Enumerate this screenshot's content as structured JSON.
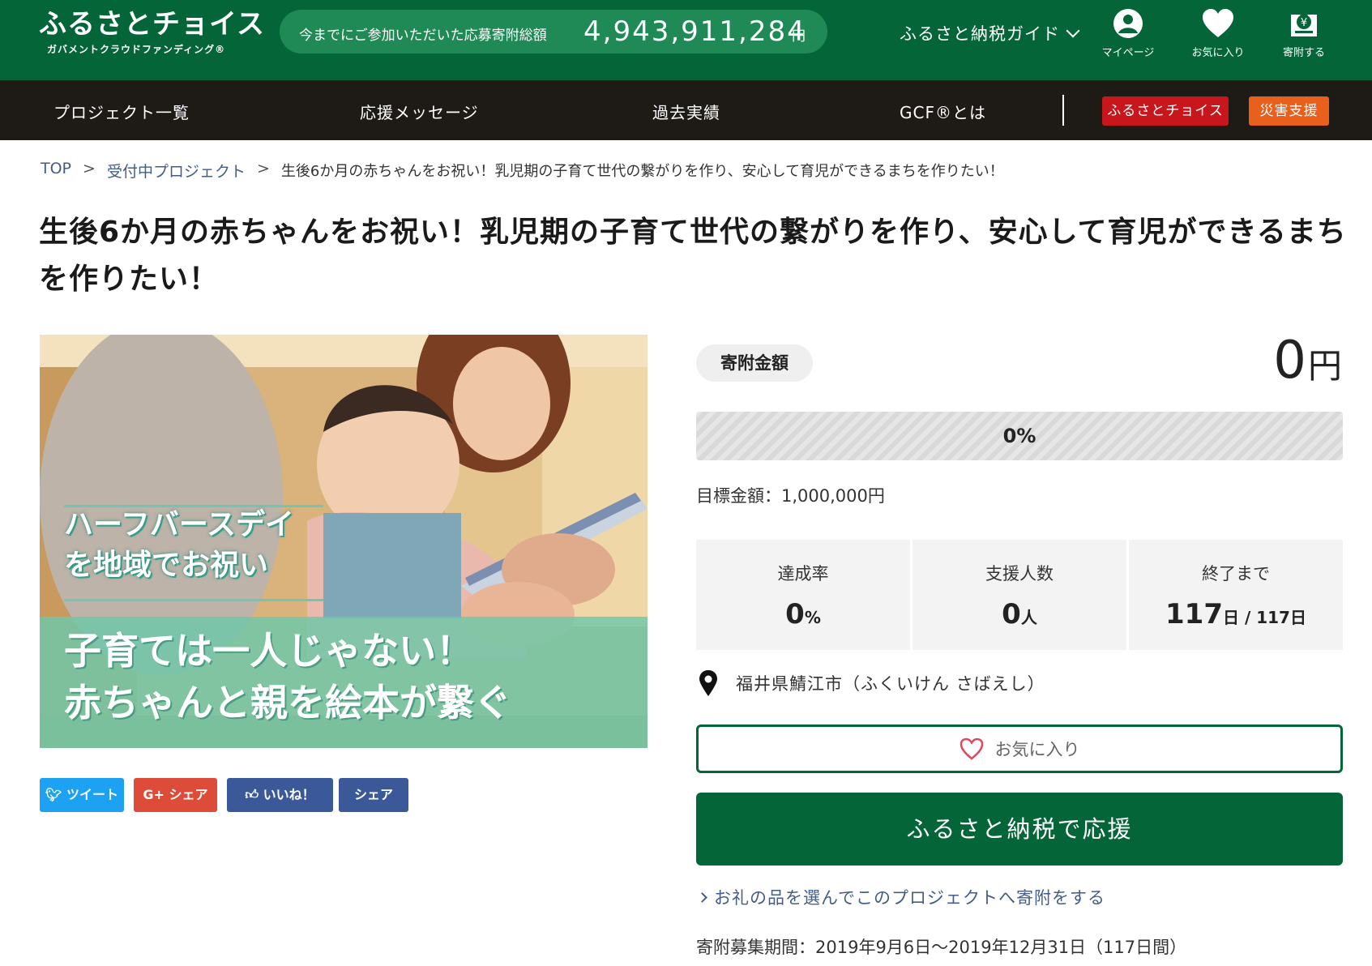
{
  "header": {
    "logo_main": "ふるさとチョイス",
    "logo_sub": "ガバメントクラウドファンディング®",
    "total_label": "今までにご参加いただいた応募寄附総額",
    "total_value": "4,943,911,284",
    "total_unit": "円",
    "guide_label": "ふるさと納税ガイド",
    "icons": [
      {
        "label": "マイページ",
        "icon": "user-icon"
      },
      {
        "label": "お気に入り",
        "icon": "heart-icon"
      },
      {
        "label": "寄附する",
        "icon": "donate-icon"
      }
    ]
  },
  "nav": {
    "items": [
      "プロジェクト一覧",
      "応援メッセージ",
      "過去実績",
      "GCF®とは"
    ],
    "btn_choice": "ふるさとチョイス",
    "btn_disaster": "災害支援",
    "colors": {
      "bg": "#1e1b17",
      "choice": "#c8161d",
      "disaster": "#e8601c"
    }
  },
  "breadcrumb": {
    "top": "TOP",
    "sep": ">",
    "projects": "受付中プロジェクト",
    "current": "生後6か月の赤ちゃんをお祝い！乳児期の子育て世代の繋がりを作り、安心して育児ができるまちを作りたい！"
  },
  "title": "生後6か月の赤ちゃんをお祝い！乳児期の子育て世代の繋がりを作り、安心して育児ができるまちを作りたい！",
  "hero": {
    "caption_top_1": "ハーフバースデイ",
    "caption_top_2": "を地域でお祝い",
    "caption_main_1": "子育ては一人じゃない！",
    "caption_main_2": "赤ちゃんと親を絵本が繋ぐ"
  },
  "share": {
    "tweet": "ツイート",
    "gplus": "シェア",
    "like": "いいね！",
    "fb_share": "シェア"
  },
  "panel": {
    "amount_label": "寄附金額",
    "amount_value": "0",
    "amount_unit": "円",
    "progress_fraction": 0,
    "progress_label": "0%",
    "target": "目標金額：1,000,000円",
    "stats": [
      {
        "label": "達成率",
        "value": "0",
        "unit": "%"
      },
      {
        "label": "支援人数",
        "value": "0",
        "unit": "人"
      },
      {
        "label": "終了まで",
        "value": "117",
        "unit": "日 / 117日"
      }
    ],
    "location": "福井県鯖江市（ふくいけん さばえし）",
    "favorite": "お気に入り",
    "support": "ふるさと納税で応援",
    "gift_link": "お礼の品を選んでこのプロジェクトへ寄附をする",
    "period": "寄附募集期間：2019年9月6日～2019年12月31日（117日間）",
    "accent": "#046538"
  }
}
